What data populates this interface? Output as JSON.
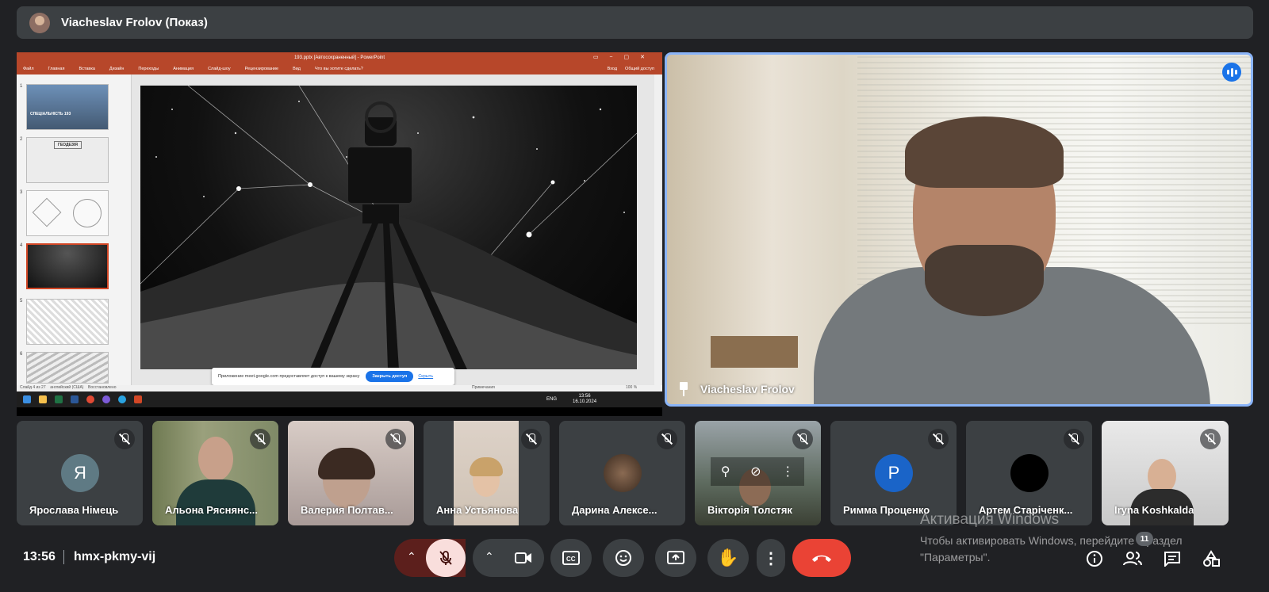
{
  "top_bar": {
    "presenter_label": "Viacheslav Frolov (Показ)"
  },
  "presentation": {
    "file_title": "193.pptx [Автосохраненный] - PowerPoint",
    "ribbon_tabs": [
      "Файл",
      "Главная",
      "Вставка",
      "Дизайн",
      "Переходы",
      "Анимация",
      "Слайд-шоу",
      "Рецензирование",
      "Вид",
      "Что вы хотите сделать?"
    ],
    "ribbon_right": [
      "Вход",
      "Общий доступ"
    ],
    "thumbnail_numbers": [
      "1",
      "2",
      "3",
      "4",
      "5",
      "6"
    ],
    "thumb1_caption": "СПЕЦІАЛЬНІСТЬ 193",
    "thumb2_caption": "ГЕОДЕЗІЯ",
    "status_left": "Слайд 4 из 27",
    "status_lang": "английский (США)",
    "status_restore": "Восстановлено",
    "status_notes": "Примечания",
    "zoom": "100 %",
    "share_banner_text": "Приложение meet.google.com предоставляет доступ к вашему экрану",
    "stop_sharing_label": "Закрыть доступ",
    "hide_label": "Скрыть",
    "taskbar_lang": "ENG",
    "taskbar_time": "13:56",
    "taskbar_date": "16.10.2024"
  },
  "speaker": {
    "name": "Viacheslav Frolov"
  },
  "participants": [
    {
      "name": "Ярослава Німець",
      "initial": "Я",
      "avatar_color": "#5f7a84"
    },
    {
      "name": "Альона Ряснянс..."
    },
    {
      "name": "Валерия Полтав..."
    },
    {
      "name": "Анна Устьянова"
    },
    {
      "name": "Дарина Алексе..."
    },
    {
      "name": "Вікторія Толстяк"
    },
    {
      "name": "Римма Проценко",
      "initial": "P",
      "avatar_color": "#1a64c8"
    },
    {
      "name": "Артем Старіченк...",
      "avatar_color": "#000000"
    },
    {
      "name": "Iryna Koshkalda"
    }
  ],
  "watermark": {
    "line1": "Активация Windows",
    "line2": "Чтобы активировать Windows, перейдите в раздел",
    "line3": "\"Параметры\"."
  },
  "bottom_bar": {
    "time": "13:56",
    "meeting_code": "hmx-pkmy-vij",
    "participant_count": "11"
  },
  "colors": {
    "end_call": "#ea4335",
    "mic_off_bg": "#f9dedc",
    "active_border": "#8ab4f8",
    "ppt_red": "#b7472a"
  }
}
